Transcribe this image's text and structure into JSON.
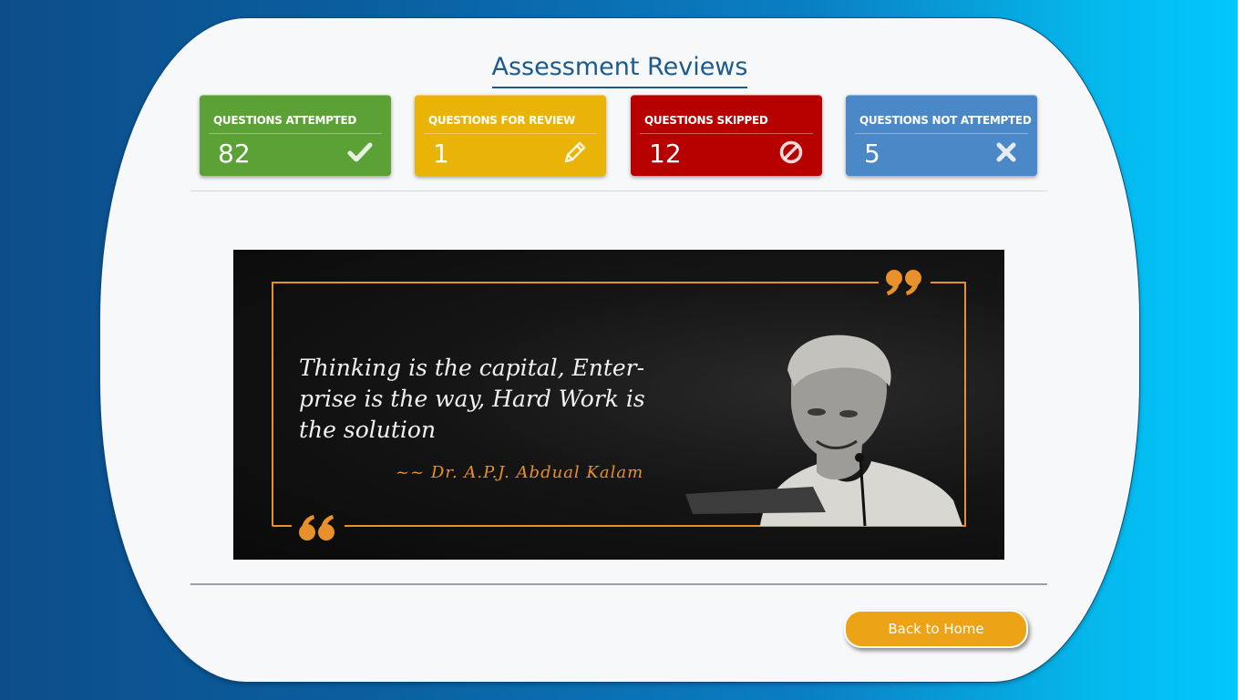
{
  "header": {
    "title": "Assessment Reviews"
  },
  "stats": [
    {
      "label": "QUESTIONS ATTEMPTED",
      "value": "82",
      "icon": "check-icon",
      "color": "#5ba135"
    },
    {
      "label": "QUESTIONS FOR REVIEW",
      "value": "1",
      "icon": "pencil-icon",
      "color": "#eab308"
    },
    {
      "label": "QUESTIONS SKIPPED",
      "value": "12",
      "icon": "ban-icon",
      "color": "#b70000"
    },
    {
      "label": "QUESTIONS NOT ATTEMPTED",
      "value": "5",
      "icon": "close-icon",
      "color": "#4a88c8"
    }
  ],
  "quote": {
    "text": "Thinking is the capital, Enter-prise is the way, Hard Work is the solution",
    "author": "~~ Dr. A.P.J. Abdual Kalam",
    "accent_color": "#e8902a"
  },
  "footer": {
    "home_button_label": "Back to Home",
    "home_button_color": "#eda316"
  }
}
